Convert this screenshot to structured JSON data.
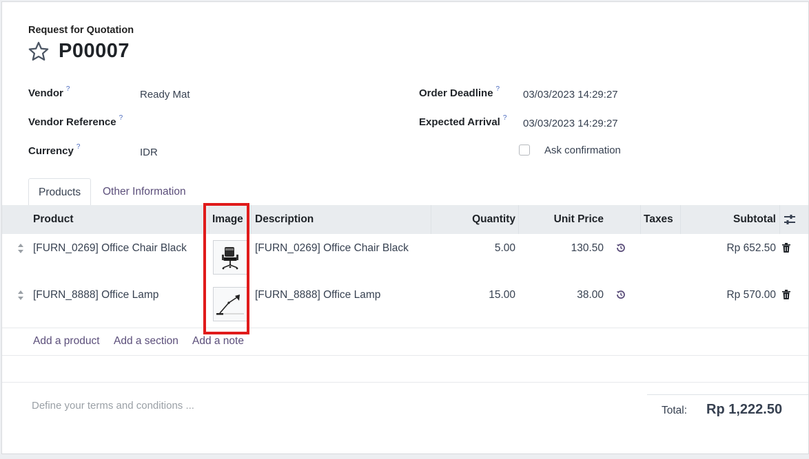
{
  "header": {
    "subtitle": "Request for Quotation",
    "title": "P00007"
  },
  "fields": {
    "vendor": {
      "label": "Vendor",
      "help": "?",
      "value": "Ready Mat"
    },
    "vendor_reference": {
      "label": "Vendor Reference",
      "help": "?",
      "value": ""
    },
    "currency": {
      "label": "Currency",
      "help": "?",
      "value": "IDR"
    },
    "order_deadline": {
      "label": "Order Deadline",
      "help": "?",
      "value": "03/03/2023 14:29:27"
    },
    "expected_arrival": {
      "label": "Expected Arrival",
      "help": "?",
      "value": "03/03/2023 14:29:27"
    },
    "ask_confirmation": {
      "label": "Ask confirmation",
      "checked": false
    }
  },
  "tabs": [
    {
      "label": "Products",
      "active": true
    },
    {
      "label": "Other Information",
      "active": false
    }
  ],
  "table": {
    "columns": [
      "Product",
      "Image",
      "Description",
      "Quantity",
      "Unit Price",
      "Taxes",
      "Subtotal"
    ],
    "rows": [
      {
        "product": "[FURN_0269] Office Chair Black",
        "image": "office-chair",
        "description": "[FURN_0269] Office Chair Black",
        "quantity": "5.00",
        "unit_price": "130.50",
        "taxes": "",
        "subtotal": "Rp 652.50"
      },
      {
        "product": "[FURN_8888] Office Lamp",
        "image": "office-lamp",
        "description": "[FURN_8888] Office Lamp",
        "quantity": "15.00",
        "unit_price": "38.00",
        "taxes": "",
        "subtotal": "Rp 570.00"
      }
    ],
    "actions": {
      "add_product": "Add a product",
      "add_section": "Add a section",
      "add_note": "Add a note"
    }
  },
  "footer": {
    "terms_placeholder": "Define your terms and conditions ...",
    "total_label": "Total:",
    "total_value": "Rp 1,222.50"
  },
  "colors": {
    "accent": "#5b4e7a",
    "highlight": "#e01b1b",
    "header_bg": "#e9ecef"
  }
}
